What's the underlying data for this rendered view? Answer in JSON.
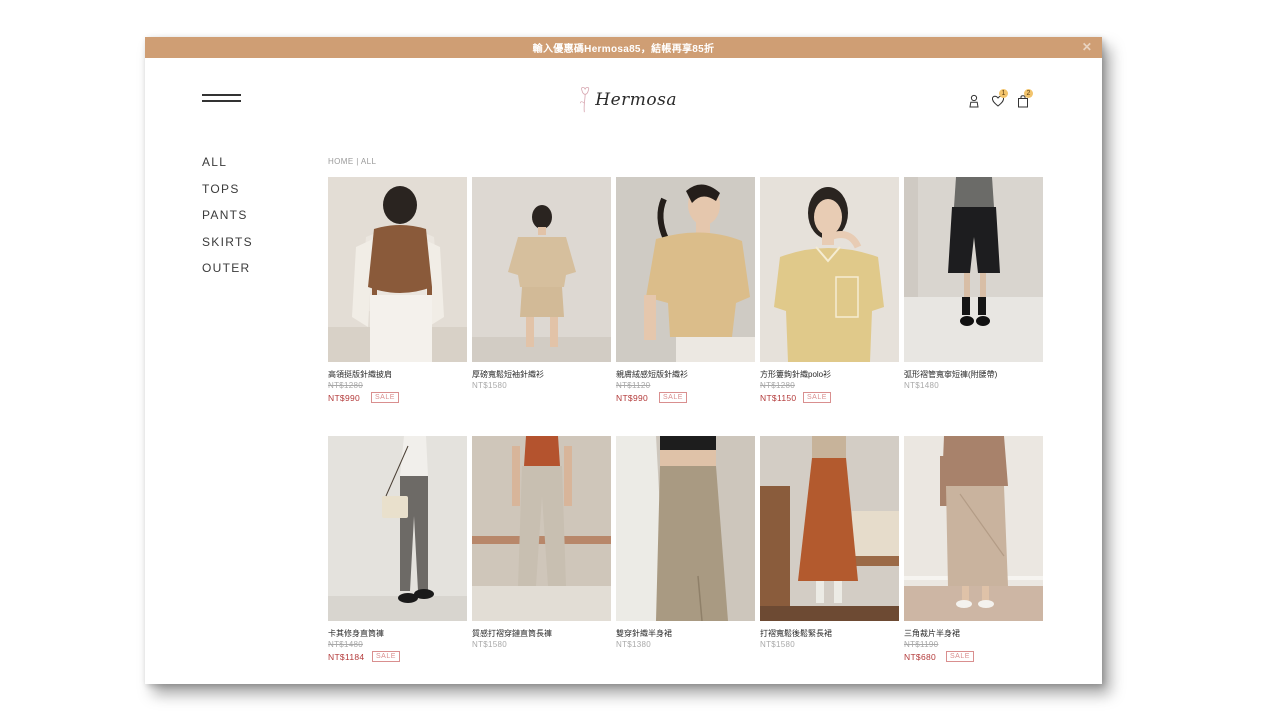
{
  "promo": {
    "text": "輸入優惠碼Hermosa85，結帳再享85折",
    "close_icon": "close-icon"
  },
  "header": {
    "logo_text": "Hermosa",
    "wishlist_count": "1",
    "cart_count": "2"
  },
  "sidebar": {
    "items": [
      {
        "label": "ALL"
      },
      {
        "label": "TOPS"
      },
      {
        "label": "PANTS"
      },
      {
        "label": "SKIRTS"
      },
      {
        "label": "OUTER"
      }
    ]
  },
  "breadcrumb": {
    "home": "HOME",
    "separator": "|",
    "current": "ALL"
  },
  "products": [
    {
      "name": "高領挺版針織披肩",
      "old_price": "NT$1280",
      "price": "NT$990",
      "sale": "SALE"
    },
    {
      "name": "厚磅寬鬆短袖針織衫",
      "price": "NT$1580"
    },
    {
      "name": "親膚絨感短版針織衫",
      "old_price": "NT$1120",
      "price": "NT$990",
      "sale": "SALE"
    },
    {
      "name": "方形簍鉤針織polo衫",
      "old_price": "NT$1280",
      "price": "NT$1150",
      "sale": "SALE"
    },
    {
      "name": "弧形褶管寬寧短褲(附腰帶)",
      "price": "NT$1480"
    },
    {
      "name": "卡其修身直筒褲",
      "old_price": "NT$1480",
      "price": "NT$1184",
      "sale": "SALE"
    },
    {
      "name": "質感打褶穿鏈直筒長褲",
      "price": "NT$1580"
    },
    {
      "name": "雙穿針織半身裙",
      "price": "NT$1380"
    },
    {
      "name": "打褶寬鬆後鬆緊長裙",
      "price": "NT$1580"
    },
    {
      "name": "三角裁片半身裙",
      "old_price": "NT$1190",
      "price": "NT$680",
      "sale": "SALE"
    }
  ],
  "colors": {
    "accent": "#cf9e74",
    "sale_red": "#b33a3a",
    "sale_tag": "#d98f8f"
  }
}
